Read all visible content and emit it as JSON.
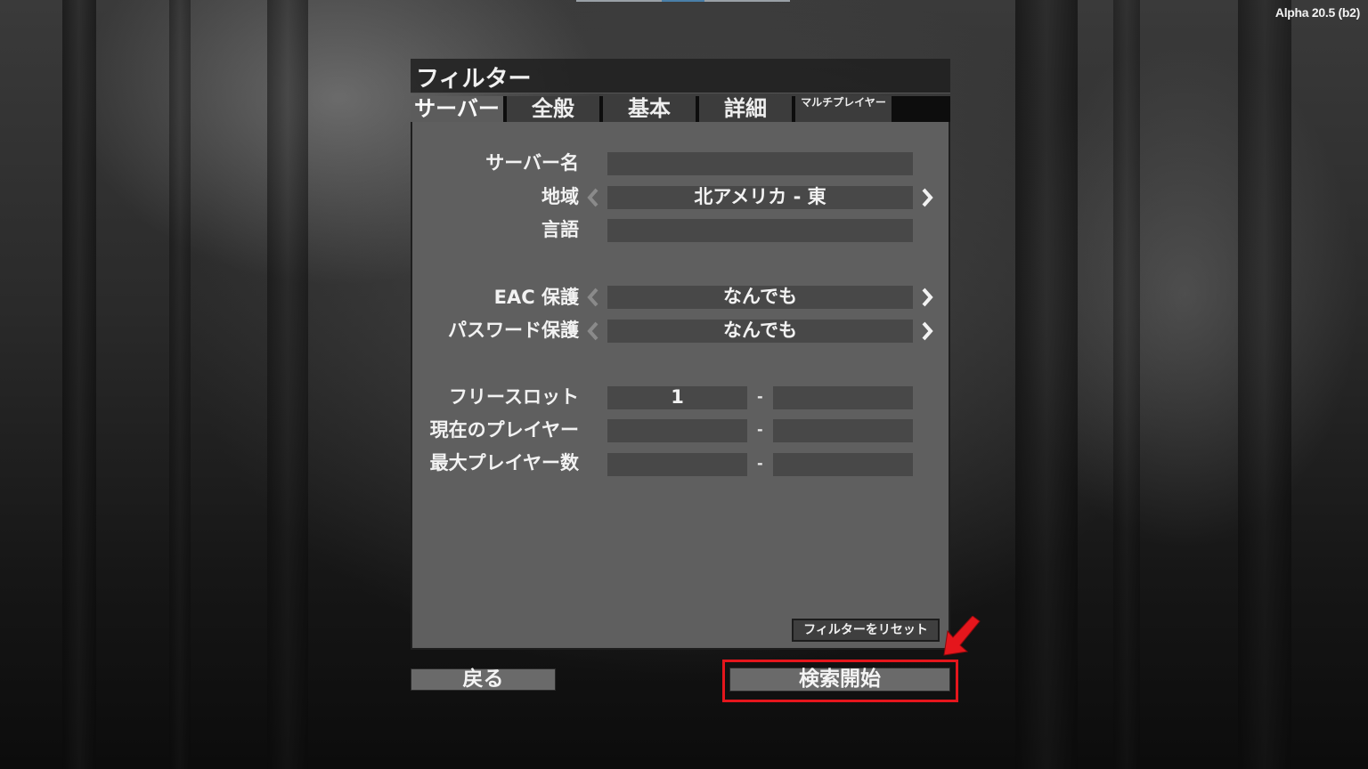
{
  "version": "Alpha 20.5 (b2)",
  "window": {
    "title": "フィルター"
  },
  "tabs": [
    {
      "label": "サーバー",
      "active": true
    },
    {
      "label": "全般",
      "active": false
    },
    {
      "label": "基本",
      "active": false
    },
    {
      "label": "詳細",
      "active": false
    },
    {
      "label": "マルチプレイヤー",
      "active": false
    }
  ],
  "fields": {
    "server_name": {
      "label": "サーバー名",
      "value": ""
    },
    "region": {
      "label": "地域",
      "value": "北アメリカ - 東"
    },
    "language": {
      "label": "言語",
      "value": ""
    },
    "eac": {
      "label": "EAC 保護",
      "value": "なんでも"
    },
    "password": {
      "label": "パスワード保護",
      "value": "なんでも"
    },
    "free_slots": {
      "label": "フリースロット",
      "min": "1",
      "max": ""
    },
    "current_players": {
      "label": "現在のプレイヤー",
      "min": "",
      "max": ""
    },
    "max_players": {
      "label": "最大プレイヤー数",
      "min": "",
      "max": ""
    }
  },
  "range_separator": "-",
  "buttons": {
    "reset": "フィルターをリセット",
    "back": "戻る",
    "search": "検索開始"
  },
  "colors": {
    "highlight": "#e5161c",
    "panel": "#5f5f5f",
    "field": "#484848"
  }
}
